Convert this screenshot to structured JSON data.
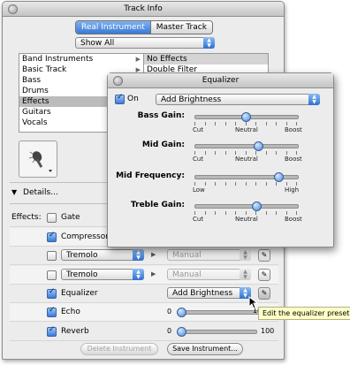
{
  "track_info": {
    "title": "Track Info",
    "tabs": [
      "Real Instrument",
      "Master Track"
    ],
    "active_tab": 0,
    "filter_popup": "Show All",
    "categories": [
      "Band Instruments",
      "Basic Track",
      "Bass",
      "Drums",
      "Effects",
      "Guitars",
      "Vocals"
    ],
    "selected_category": "Effects",
    "presets": [
      "No Effects",
      "Double Filter"
    ],
    "selected_preset": "No Effects",
    "details_label": "Details...",
    "effects_label": "Effects:",
    "effects": [
      {
        "name": "Gate",
        "checked": false,
        "kind": "plain"
      },
      {
        "name": "Compressor",
        "checked": true,
        "kind": "plain"
      },
      {
        "name": "Tremolo",
        "checked": false,
        "kind": "popup",
        "preset": "Manual"
      },
      {
        "name": "Tremolo",
        "checked": false,
        "kind": "popup",
        "preset": "Manual"
      },
      {
        "name": "Equalizer",
        "checked": true,
        "kind": "preset",
        "preset": "Add Brightness"
      },
      {
        "name": "Echo",
        "checked": true,
        "kind": "slider",
        "min": "0",
        "max": "100",
        "value": 0
      },
      {
        "name": "Reverb",
        "checked": true,
        "kind": "slider",
        "min": "0",
        "max": "100",
        "value": 0
      }
    ],
    "delete_button": "Delete Instrument",
    "save_button": "Save Instrument..."
  },
  "equalizer": {
    "title": "Equalizer",
    "on_label": "On",
    "on_checked": true,
    "preset": "Add Brightness",
    "sliders": [
      {
        "label": "Bass Gain:",
        "left": "Cut",
        "mid": "Neutral",
        "right": "Boost",
        "value": 0.5
      },
      {
        "label": "Mid Gain:",
        "left": "Cut",
        "mid": "Neutral",
        "right": "Boost",
        "value": 0.62
      },
      {
        "label": "Mid Frequency:",
        "left": "Low",
        "mid": "",
        "right": "High",
        "value": 0.82
      },
      {
        "label": "Treble Gain:",
        "left": "Cut",
        "mid": "Neutral",
        "right": "Boost",
        "value": 0.6
      }
    ]
  },
  "tooltip": "Edit the equalizer preset.",
  "colors": {
    "accent_blue": "#3a79d6",
    "window_bg": "#ececec",
    "tooltip_bg": "#ffffc6"
  }
}
